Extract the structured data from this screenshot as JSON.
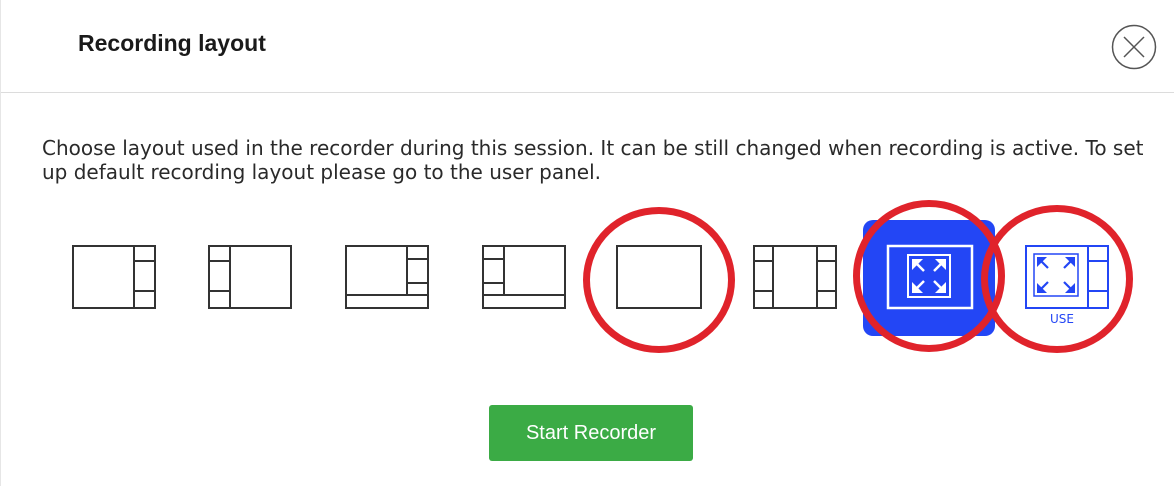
{
  "dialog": {
    "title": "Recording layout",
    "description": "Choose layout used in the recorder during this session. It can be still changed when recording is active. To set up default recording layout please go to the user panel.",
    "layouts": [
      {
        "name": "main-with-right-sidebar"
      },
      {
        "name": "main-with-left-sidebar"
      },
      {
        "name": "main-with-right-sidebar-and-bottom-bar"
      },
      {
        "name": "main-with-left-sidebar-and-bottom-bar"
      },
      {
        "name": "single-screen"
      },
      {
        "name": "main-with-both-sidebars"
      },
      {
        "name": "fullscreen",
        "selected": true
      },
      {
        "name": "fullscreen-with-sidebar",
        "label": "USE"
      }
    ],
    "start_button_label": "Start Recorder"
  },
  "colors": {
    "accent": "#2346f5",
    "highlight_circle": "#e0232b",
    "start_button": "#3bab45"
  },
  "icons": [
    "close-icon",
    "expand-icon"
  ]
}
